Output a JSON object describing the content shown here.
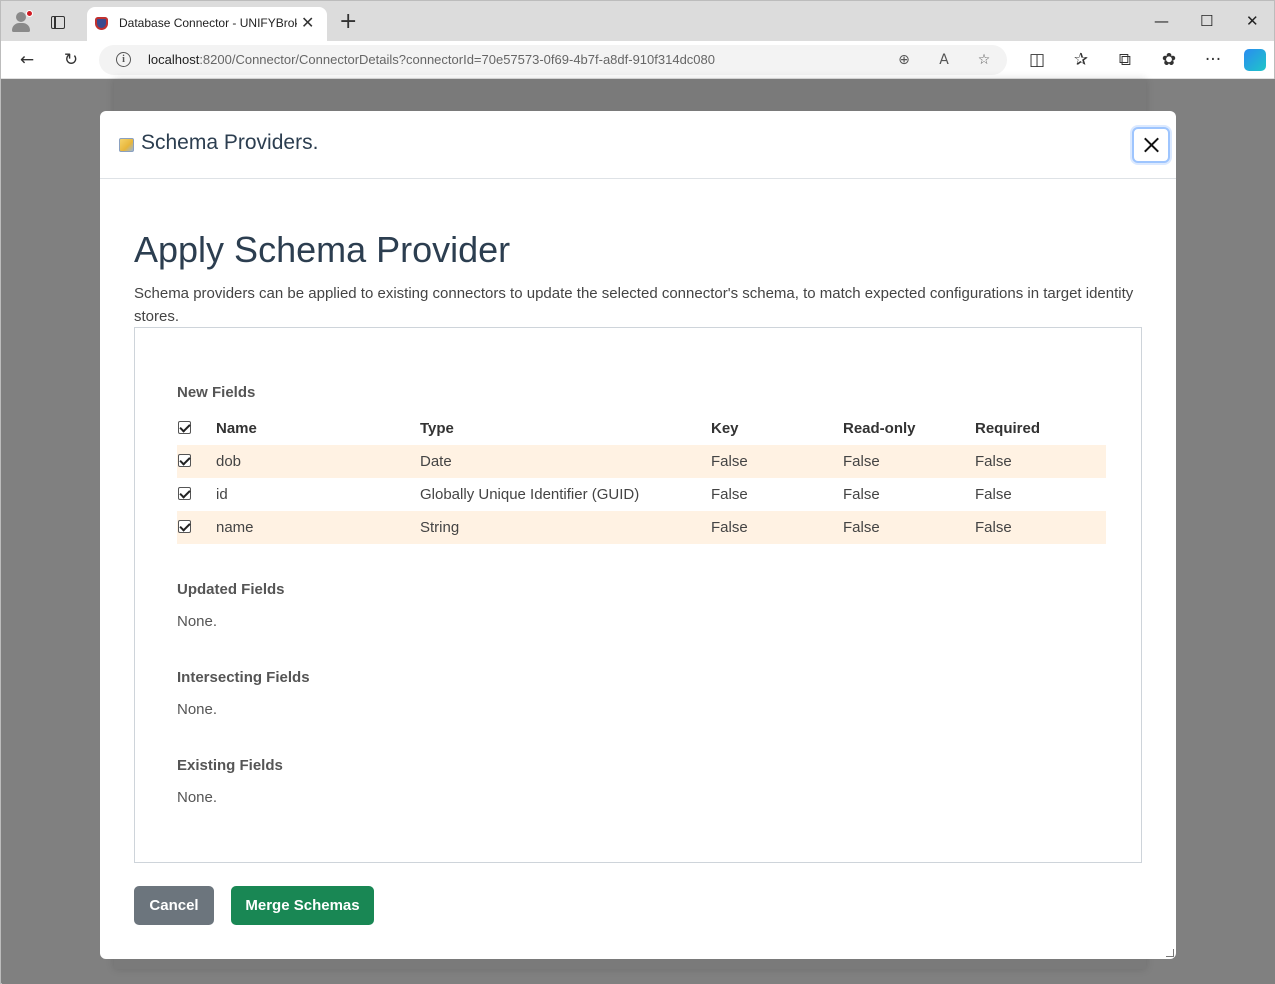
{
  "browser": {
    "tab_title": "Database Connector - UNIFYBroker",
    "tab_close": "✕",
    "new_tab": "+",
    "window_controls": {
      "minimize": "—",
      "maximize": "☐",
      "close": "✕"
    },
    "url_host": "localhost",
    "url_rest": ":8200/Connector/ConnectorDetails?connectorId=70e57573-0f69-4b7f-a8df-910f314dc080",
    "nav_icons": {
      "back": "←",
      "refresh": "↻"
    },
    "toolbar_icons": {
      "zoom": "⊕",
      "read_aloud": "A",
      "favorite": "☆",
      "split": "◫",
      "favorites": "✰",
      "collections": "⧉",
      "extensions": "✿",
      "more": "···"
    }
  },
  "modal": {
    "header_title": "Schema Providers.",
    "heading": "Apply Schema Provider",
    "description": "Schema providers can be applied to existing connectors to update the selected connector's schema, to match expected configurations in target identity stores.",
    "new_fields": {
      "title": "New Fields",
      "columns": {
        "name": "Name",
        "type": "Type",
        "key": "Key",
        "readonly": "Read-only",
        "required": "Required"
      },
      "rows": [
        {
          "name": "dob",
          "type": "Date",
          "key": "False",
          "readonly": "False",
          "required": "False",
          "checked": true
        },
        {
          "name": "id",
          "type": "Globally Unique Identifier (GUID)",
          "key": "False",
          "readonly": "False",
          "required": "False",
          "checked": true
        },
        {
          "name": "name",
          "type": "String",
          "key": "False",
          "readonly": "False",
          "required": "False",
          "checked": true
        }
      ]
    },
    "updated_fields": {
      "title": "Updated Fields",
      "value": "None."
    },
    "intersecting_fields": {
      "title": "Intersecting Fields",
      "value": "None."
    },
    "existing_fields": {
      "title": "Existing Fields",
      "value": "None."
    },
    "buttons": {
      "cancel": "Cancel",
      "merge": "Merge Schemas"
    }
  }
}
